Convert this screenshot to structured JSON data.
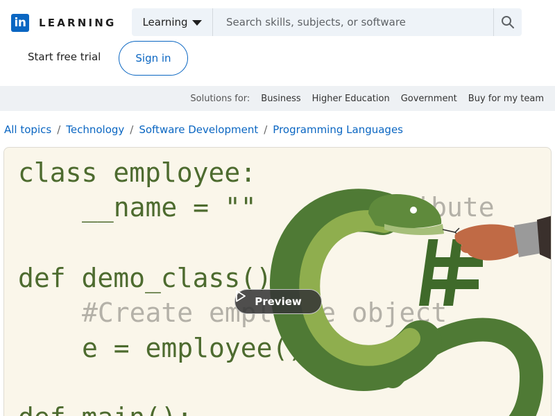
{
  "brand": {
    "logo_mark": "in",
    "product": "LEARNING",
    "accent": "#0a66c2"
  },
  "search": {
    "scope_label": "Learning",
    "placeholder": "Search skills, subjects, or software",
    "icon": "search-icon"
  },
  "header": {
    "trial_label": "Start free trial",
    "signin_label": "Sign in"
  },
  "solutions": {
    "label": "Solutions for:",
    "links": [
      "Business",
      "Higher Education",
      "Government",
      "Buy for my team"
    ]
  },
  "breadcrumb": {
    "items": [
      "All topics",
      "Technology",
      "Software Development",
      "Programming Languages"
    ],
    "separator": "/"
  },
  "hero": {
    "code_lines": {
      "l1": "class employee:",
      "l2": "__name = \"\"",
      "l2_comment": "# attribute",
      "l3": "def demo_class():",
      "l4": "#Create employee object",
      "l5": "e = employee()",
      "l6": "def main():"
    },
    "preview_label": "Preview",
    "colors": {
      "background": "#faf6ea",
      "code_green": "#4d6b2f",
      "comment_gray": "#b4b1a8",
      "snake_dark": "#4f7a35",
      "snake_light": "#8fae4e"
    }
  }
}
